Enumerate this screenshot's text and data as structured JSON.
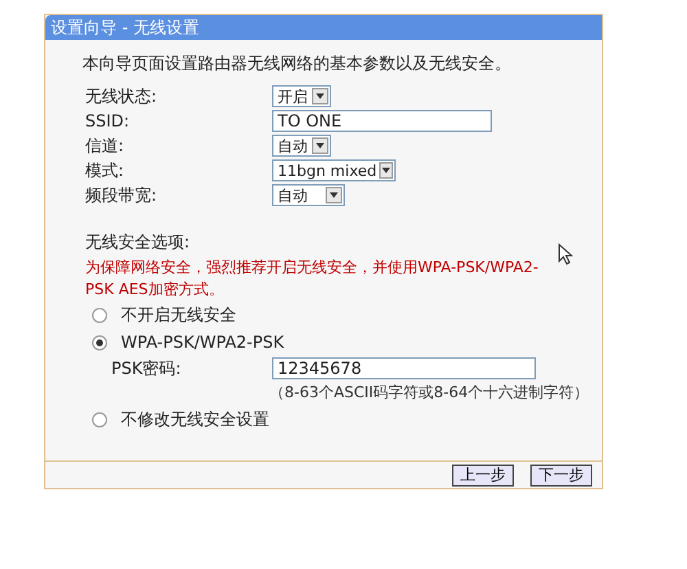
{
  "window": {
    "title": "设置向导 - 无线设置"
  },
  "intro": "本向导页面设置路由器无线网络的基本参数以及无线安全。",
  "fields": [
    {
      "kind": "select",
      "label": "无线状态:",
      "value": "开启"
    },
    {
      "kind": "text",
      "label": "SSID:",
      "value": "TO ONE"
    },
    {
      "kind": "select",
      "label": "信道:",
      "value": "自动"
    },
    {
      "kind": "select",
      "label": "模式:",
      "value": "11bgn mixed"
    },
    {
      "kind": "select",
      "label": "频段带宽:",
      "value": "自动"
    }
  ],
  "security": {
    "title": "无线安全选项:",
    "warning": "为保障网络安全，强烈推荐开启无线安全，并使用WPA-PSK/WPA2-PSK AES加密方式。",
    "options": [
      {
        "label": "不开启无线安全",
        "selected": false
      },
      {
        "label": "WPA-PSK/WPA2-PSK",
        "selected": true,
        "psk_label": "PSK密码:",
        "psk_value": "12345678",
        "psk_hint": "（8-63个ASCII码字符或8-64个十六进制字符）"
      },
      {
        "label": "不修改无线安全设置",
        "selected": false
      }
    ]
  },
  "buttons": [
    "上一步",
    "下一步"
  ]
}
